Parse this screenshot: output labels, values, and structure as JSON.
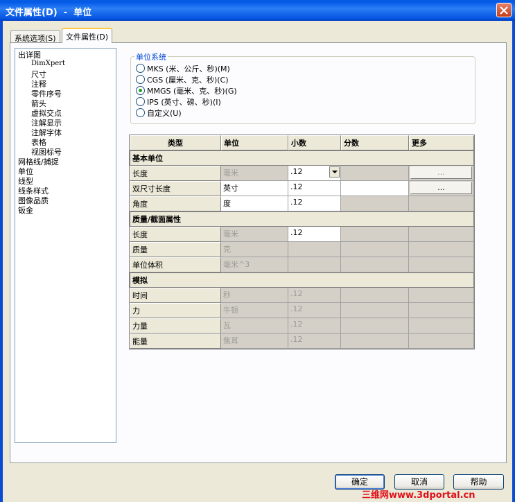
{
  "window": {
    "title": "文件属性(D)  -  单位"
  },
  "tabs": [
    {
      "label": "系统选项(S)"
    },
    {
      "label": "文件属性(D)"
    }
  ],
  "tree": {
    "items": [
      {
        "label": "出详图"
      },
      {
        "label": "DimXpert"
      },
      {
        "label": "尺寸"
      },
      {
        "label": "注释"
      },
      {
        "label": "零件序号"
      },
      {
        "label": "箭头"
      },
      {
        "label": "虚拟交点"
      },
      {
        "label": "注解显示"
      },
      {
        "label": "注解字体"
      },
      {
        "label": "表格"
      },
      {
        "label": "视图标号"
      },
      {
        "label": "网格线/捕捉"
      },
      {
        "label": "单位"
      },
      {
        "label": "线型"
      },
      {
        "label": "线条样式"
      },
      {
        "label": "图像品质"
      },
      {
        "label": "钣金"
      }
    ]
  },
  "unit_system": {
    "group_label": "单位系统",
    "options": [
      {
        "label": "MKS (米、公斤、秒)(M)",
        "selected": false
      },
      {
        "label": "CGS (厘米、克、秒)(C)",
        "selected": false
      },
      {
        "label": "MMGS (毫米、克、秒)(G)",
        "selected": true
      },
      {
        "label": "IPS (英寸、磅、秒)(I)",
        "selected": false
      },
      {
        "label": "自定义(U)",
        "selected": false
      }
    ]
  },
  "grid": {
    "headers": [
      "类型",
      "单位",
      "小数",
      "分数",
      "更多"
    ],
    "sections": [
      {
        "title": "基本单位",
        "rows": [
          {
            "type": "长度",
            "unit": "毫米",
            "decimal": ".12",
            "more": "..."
          },
          {
            "type": "双尺寸长度",
            "unit": "英寸",
            "decimal": ".12",
            "more": "..."
          },
          {
            "type": "角度",
            "unit": "度",
            "decimal": ".12",
            "more": ""
          }
        ]
      },
      {
        "title": "质量/截面属性",
        "rows": [
          {
            "type": "长度",
            "unit": "毫米",
            "decimal": ".12"
          },
          {
            "type": "质量",
            "unit": "克",
            "decimal": ""
          },
          {
            "type": "单位体积",
            "unit": "毫米^3",
            "decimal": ""
          }
        ]
      },
      {
        "title": "模拟",
        "rows": [
          {
            "type": "时间",
            "unit": "秒",
            "decimal": ".12"
          },
          {
            "type": "力",
            "unit": "牛顿",
            "decimal": ".12"
          },
          {
            "type": "力量",
            "unit": "瓦",
            "decimal": ".12"
          },
          {
            "type": "能量",
            "unit": "焦耳",
            "decimal": ".12"
          }
        ]
      }
    ]
  },
  "buttons": {
    "ok": "确定",
    "cancel": "取消",
    "help": "帮助"
  },
  "watermark": "三维网www.3dportal.cn"
}
